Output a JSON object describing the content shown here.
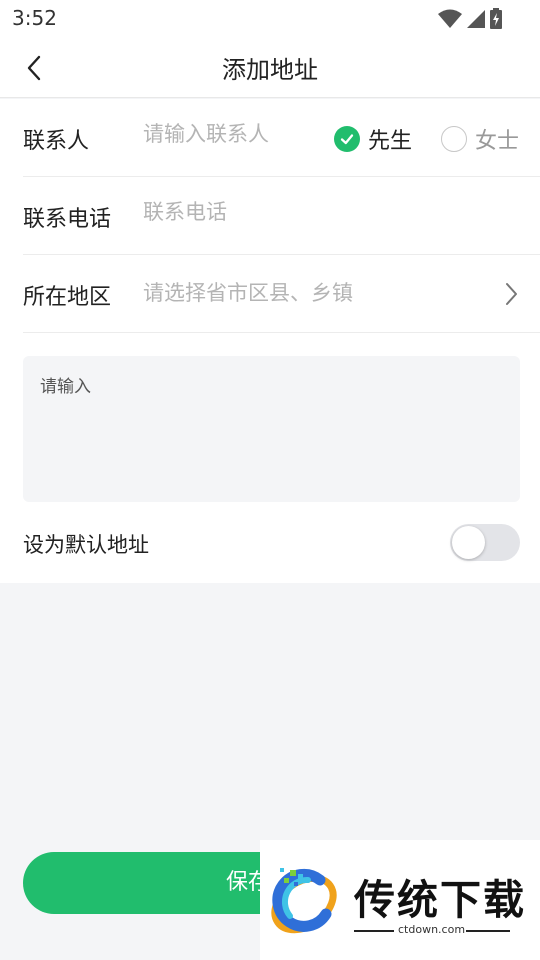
{
  "status_bar": {
    "time": "3:52"
  },
  "header": {
    "title": "添加地址"
  },
  "form": {
    "contact": {
      "label": "联系人",
      "placeholder": "请输入联系人",
      "gender_options": [
        {
          "label": "先生",
          "selected": true
        },
        {
          "label": "女士",
          "selected": false
        }
      ]
    },
    "phone": {
      "label": "联系电话",
      "placeholder": "联系电话"
    },
    "region": {
      "label": "所在地区",
      "placeholder": "请选择省市区县、乡镇"
    },
    "address_detail": {
      "placeholder": "请输入"
    },
    "default_address": {
      "label": "设为默认地址",
      "enabled": false
    }
  },
  "save_button": {
    "label": "保存地址"
  },
  "watermark": {
    "title": "传统下载",
    "url": "ctdown.com"
  },
  "colors": {
    "accent": "#21bd6d",
    "background": "#f4f5f7",
    "placeholder": "#b4b4b4"
  }
}
